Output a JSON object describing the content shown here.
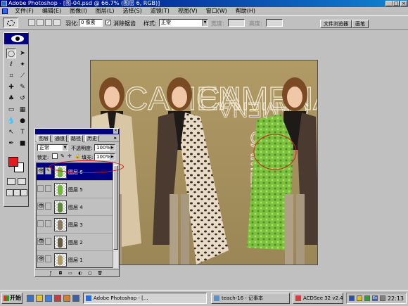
{
  "window": {
    "title": "Adobe Photoshop - [图-04.psd @ 66.7% (图层 6, RGB)]",
    "title_buttons": [
      "_",
      "□",
      "×"
    ]
  },
  "menu": {
    "items": [
      "文件(F)",
      "编辑(E)",
      "图像(I)",
      "图层(L)",
      "选择(S)",
      "滤镜(T)",
      "视图(V)",
      "窗口(W)",
      "帮助(H)"
    ]
  },
  "options": {
    "feather_label": "羽化:",
    "feather_value": "0 像素",
    "antialias_label": "消除锯齿",
    "style_label": "样式:",
    "style_value": "正常",
    "width_label": "宽度:",
    "height_label": "高度:",
    "tabs": [
      "文件浏览器",
      "画笔"
    ]
  },
  "document": {
    "overlay_text_1": "CAMEN",
    "overlay_text_2": "CAMENA",
    "overlay_text_3": "CAMENA",
    "vertical_text": "CAMENA"
  },
  "layers_panel": {
    "tabs": [
      "图层",
      "通道",
      "路径",
      "历史"
    ],
    "blend_mode": "正常",
    "opacity_label": "不透明度:",
    "opacity_value": "100%",
    "lock_label": "锁定:",
    "fill_label": "填充:",
    "fill_value": "100%",
    "layers": [
      {
        "name": "图层 6",
        "visible": true,
        "selected": true,
        "color": "#6fb83a"
      },
      {
        "name": "图层 5",
        "visible": false,
        "selected": false,
        "color": "#6fb83a"
      },
      {
        "name": "图层 4",
        "visible": true,
        "selected": false,
        "color": "#5a8a3a"
      },
      {
        "name": "图层 3",
        "visible": false,
        "selected": false,
        "color": "#8a7a60"
      },
      {
        "name": "图层 2",
        "visible": true,
        "selected": false,
        "color": "#6a5a40"
      },
      {
        "name": "图层 1",
        "visible": true,
        "selected": false,
        "color": "#b09a60"
      }
    ]
  },
  "taskbar": {
    "start_label": "开始",
    "tasks": [
      {
        "label": "Adobe Photoshop - [...",
        "pressed": true
      },
      {
        "label": "teach-16 - 记事本",
        "pressed": false
      },
      {
        "label": "ACDSee 32 v2.4 - teach",
        "pressed": false
      }
    ],
    "clock": "22:13",
    "ime": "En"
  },
  "colors": {
    "foreground": "#e8181c",
    "background": "#ffffff",
    "title_bar": "#000080"
  }
}
